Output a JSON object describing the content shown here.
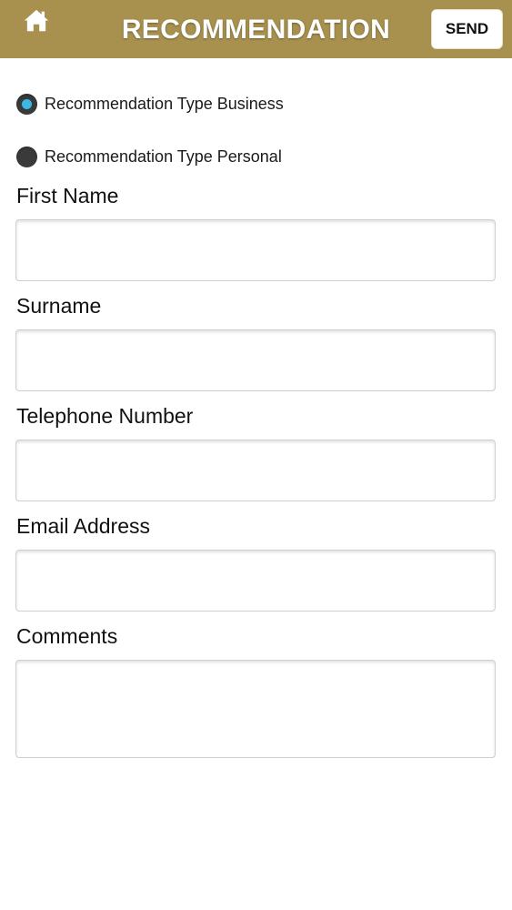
{
  "header": {
    "title": "RECOMMENDATION",
    "send_label": "SEND",
    "home_icon": "home-icon",
    "background_color": "#a8914e"
  },
  "recommendation_type": {
    "options": [
      {
        "label": "Recommendation Type Business",
        "checked": true
      },
      {
        "label": "Recommendation Type Personal",
        "checked": false
      }
    ],
    "selected_color": "#38b9e6"
  },
  "form": {
    "first_name": {
      "label": "First Name",
      "value": ""
    },
    "surname": {
      "label": "Surname",
      "value": ""
    },
    "telephone": {
      "label": "Telephone Number",
      "value": ""
    },
    "email": {
      "label": "Email Address",
      "value": ""
    },
    "comments": {
      "label": "Comments",
      "value": ""
    }
  }
}
